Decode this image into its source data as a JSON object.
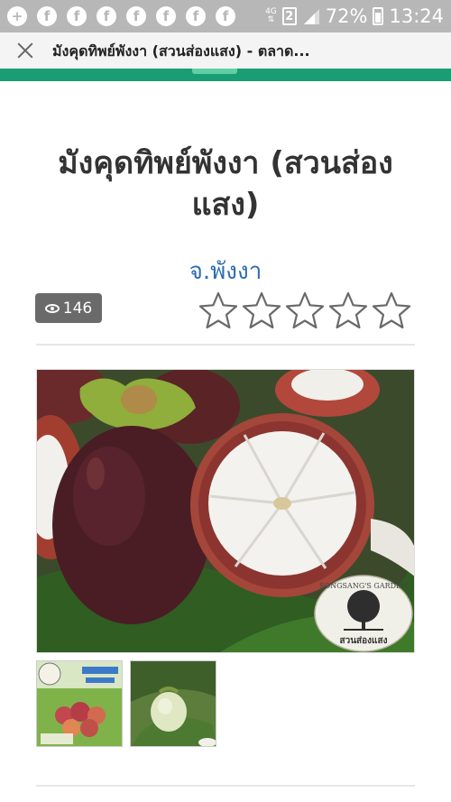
{
  "status_bar": {
    "network": "4G",
    "sim": "2",
    "battery": "72%",
    "time": "13:24"
  },
  "browser": {
    "page_title": "มังคุดทิพย์พังงา (สวนส่องแสง) - ตลาด..."
  },
  "product": {
    "title": "มังคุดทิพย์พังงา (สวนส่องแสง)",
    "province": "จ.พังงา",
    "views": "146",
    "rating": 0,
    "max_rating": 5
  },
  "logo": {
    "brand_top": "SONGSANG'S GARDEN",
    "brand_bottom": "สวนส่องแสง"
  },
  "colors": {
    "status_bar": "#b7b7b7",
    "brand_green": "#1a9d73",
    "link_blue": "#2e6db0",
    "views_badge": "#6a6a6a"
  }
}
